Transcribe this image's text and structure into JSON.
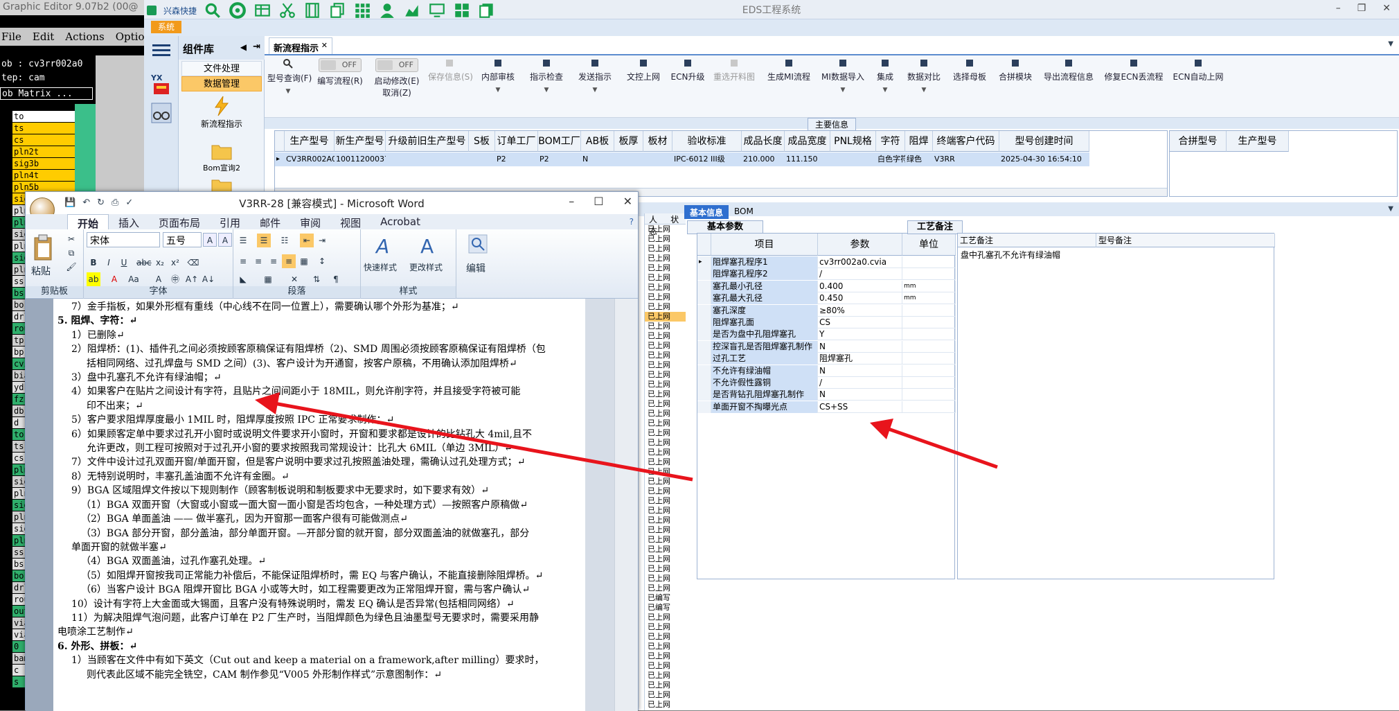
{
  "graphic_editor": {
    "title": "Graphic Editor 9.07b2 (00@",
    "menu": [
      "File",
      "Edit",
      "Actions",
      "Options"
    ],
    "job": "ob : cv3rr002a0",
    "step": "tep: cam",
    "matrix": "ob Matrix ...",
    "layers": [
      "to",
      "ts",
      "cs",
      "pln2t",
      "sig3b",
      "pln4t",
      "pln5b",
      "sig",
      "pln",
      "pln",
      "sig",
      "pln",
      "sig",
      "pln",
      "ss",
      "bs",
      "bo",
      "drl",
      "rou",
      "tp",
      "bp",
      "cvi",
      "bia",
      "ydk",
      "fzk",
      "db",
      "d",
      "to",
      "ts",
      "cs",
      "pln",
      "sig",
      "pln",
      "sig",
      "pln",
      "sig",
      "pln",
      "ss",
      "bs",
      "bo",
      "drl",
      "rou",
      "out",
      "via",
      "via",
      "0",
      "bam",
      "c",
      "s"
    ]
  },
  "eds": {
    "title": "EDS工程系统",
    "brand": "兴森快捷",
    "sys_tab": "系统",
    "library": {
      "title": "组件库",
      "items": [
        "文件处理",
        "数据管理"
      ],
      "icon_labels": [
        "新流程指示",
        "Bom宣询2"
      ]
    },
    "doc_tab": "新流程指示",
    "toolbar": {
      "model_query": "型号查询(F)",
      "edit_flow": "编写流程(R)",
      "start_modify": "启动修改(E)",
      "cancel": "取消(Z)",
      "toggle_off": "OFF",
      "items": [
        "保存信息(S)",
        "内部审核",
        "指示检查",
        "发送指示",
        "文控上网",
        "ECN升级",
        "重选开料图",
        "生成MI流程",
        "MI数据导入",
        "集成",
        "数据对比",
        "选择母板",
        "合拼模块",
        "导出流程信息",
        "修复ECN丢流程",
        "ECN自动上网"
      ]
    },
    "main_info": "主要信息",
    "grid": {
      "headers": [
        "生产型号",
        "新生产型号",
        "升级前旧生产型号",
        "S板",
        "订单工厂",
        "BOM工厂",
        "AB板",
        "板厚",
        "板材",
        "验收标准",
        "成品长度",
        "成品宽度",
        "PNL规格",
        "字符",
        "阻焊",
        "终端客户代码",
        "型号创建时间"
      ],
      "row": [
        "CV3RR002A0",
        "10011200037240",
        "",
        "",
        "P2",
        "P2",
        "N",
        "",
        "",
        "IPC-6012 III级",
        "210.000",
        "111.150",
        "",
        "白色字符",
        "绿色",
        "V3RR",
        "2025-04-30 16:54:10"
      ]
    },
    "grid2_headers": [
      "合拼型号",
      "生产型号"
    ],
    "lower_tabs": [
      "基本信息",
      "BOM"
    ],
    "basic_params": "基本参数",
    "process_tab": "工艺备注",
    "params": {
      "headers": [
        "项目",
        "参数",
        "单位"
      ],
      "rows": [
        [
          "阻焊塞孔程序1",
          "cv3rr002a0.cvia",
          ""
        ],
        [
          "阻焊塞孔程序2",
          "/",
          ""
        ],
        [
          "塞孔最小孔径",
          "0.400",
          "mm"
        ],
        [
          "塞孔最大孔径",
          "0.450",
          "mm"
        ],
        [
          "塞孔深度",
          "≥80%",
          ""
        ],
        [
          "阻焊塞孔面",
          "CS",
          ""
        ],
        [
          "是否为盘中孔阻焊塞孔",
          "Y",
          ""
        ],
        [
          "控深盲孔是否阻焊塞孔制作",
          "N",
          ""
        ],
        [
          "过孔工艺",
          "阻焊塞孔",
          ""
        ],
        [
          "不允许有绿油帽",
          "N",
          ""
        ],
        [
          "不允许假性露铜",
          "/",
          ""
        ],
        [
          "是否背钻孔阻焊塞孔制作",
          "N",
          ""
        ],
        [
          "单面开窗不掏曝光点",
          "CS+SS",
          ""
        ]
      ]
    },
    "process": {
      "headers": [
        "工艺备注",
        "型号备注"
      ],
      "note": "盘中孔塞孔不允许有绿油帽"
    },
    "status_header": "状态",
    "status_col_left": "人",
    "status_rows": [
      "已上网",
      "已上网",
      "已上网",
      "已上网",
      "已上网",
      "已上网",
      "已上网",
      "已上网",
      "已上网",
      "已上网",
      "已上网",
      "已上网",
      "已上网",
      "已上网",
      "已上网",
      "已上网",
      "已上网",
      "已上网",
      "已上网",
      "已上网",
      "已上网",
      "已上网",
      "已上网",
      "已上网",
      "已上网",
      "已上网",
      "已上网",
      "已上网",
      "已上网",
      "已上网",
      "已上网",
      "已上网",
      "已上网",
      "已上网",
      "已上网",
      "已上网",
      "已上网",
      "已上网",
      "已编写",
      "已编写",
      "已上网",
      "已上网",
      "已上网",
      "已上网",
      "已上网",
      "已上网",
      "已上网",
      "已上网",
      "已上网",
      "已上网"
    ]
  },
  "word": {
    "title": "V3RR-28 [兼容模式] - Microsoft Word",
    "tabs": [
      "开始",
      "插入",
      "页面布局",
      "引用",
      "邮件",
      "审阅",
      "视图",
      "Acrobat"
    ],
    "font_name": "宋体",
    "font_size": "五号",
    "groups": [
      "剪贴板",
      "字体",
      "段落",
      "样式"
    ],
    "paste": "粘贴",
    "quick_styles": "快速样式",
    "change_styles": "更改样式",
    "edit": "编辑",
    "lines": [
      {
        "t": "7）金手指板，如果外形框有重线（中心线不在同一位置上），需要确认哪个外形为基准；↵",
        "i": 60,
        "b": false
      },
      {
        "t": "5.   阻焊、字符：↵",
        "i": 38,
        "b": true
      },
      {
        "t": "1）已删除↵",
        "i": 60,
        "b": false
      },
      {
        "t": "2）阻焊桥：(1)、插件孔之间必须按顾客原稿保证有阻焊桥（2)、SMD 周围必须按顾客原稿保证有阻焊桥（包",
        "i": 60,
        "b": false
      },
      {
        "t": "括相同网络、过孔焊盘与 SMD 之间）(3)、客户设计为开通窗，按客户原稿，不用确认添加阻焊桥↵",
        "i": 82,
        "b": false
      },
      {
        "t": "3）盘中孔塞孔不允许有绿油帽；↵",
        "i": 60,
        "b": false
      },
      {
        "t": "4）如果客户在贴片之间设计有字符，且贴片之间间距小于 18MIL，则允许削字符，并且接受字符被可能",
        "i": 60,
        "b": false
      },
      {
        "t": "印不出来；↵",
        "i": 82,
        "b": false
      },
      {
        "t": "5）客户要求阻焊厚度最小 1MIL 时，阻焊厚度按照 IPC 正常要求制作；↵",
        "i": 60,
        "b": false
      },
      {
        "t": "6）如果顾客定单中要求过孔开小窗时或说明文件要求开小窗时，开窗和要求都是设计的比钻孔大 4mil,且不",
        "i": 60,
        "b": false
      },
      {
        "t": "允许更改，则工程可按照对于过孔开小窗的要求按照我司常规设计：比孔大 6MIL（单边 3MIL）↵",
        "i": 82,
        "b": false
      },
      {
        "t": "7）文件中设计过孔双面开窗/单面开窗，但是客户说明中要求过孔按照盖油处理，需确认过孔处理方式；↵",
        "i": 60,
        "b": false
      },
      {
        "t": "8）无特别说明时，丰塞孔盖油面不允许有金圈。↵",
        "i": 60,
        "b": false
      },
      {
        "t": "9）BGA 区域阻焊文件按以下规则制作（顾客制板说明和制板要求中无要求时，如下要求有效）↵",
        "i": 60,
        "b": false
      },
      {
        "t": "（1）BGA 双面开窗（大窗或小窗或一面大窗一面小窗是否均包含，一种处理方式）—按照客户原稿做↵",
        "i": 74,
        "b": false
      },
      {
        "t": "（2）BGA 单面盖油 —— 做半塞孔，因为开窗那一面客户很有可能做测点↵",
        "i": 74,
        "b": false
      },
      {
        "t": "（3）BGA 部分开窗，部分盖油，部分单面开窗。—开部分窗的就开窗，部分双面盖油的就做塞孔，部分",
        "i": 74,
        "b": false
      },
      {
        "t": "单面开窗的就做半塞↵",
        "i": 60,
        "b": false
      },
      {
        "t": "（4）BGA 双面盖油，过孔作塞孔处理。↵",
        "i": 74,
        "b": false
      },
      {
        "t": "（5）如阻焊开窗按我司正常能力补偿后，不能保证阻焊桥时，需 EQ 与客户确认，不能直接删除阻焊桥。↵",
        "i": 74,
        "b": false
      },
      {
        "t": "（6）当客户设计 BGA 阻焊开窗比 BGA 小或等大时，如工程需要更改为正常阻焊开窗，需与客户确认↵",
        "i": 74,
        "b": false
      },
      {
        "t": "10）设计有字符上大金面或大锡面，且客户没有特殊说明时，需发 EQ 确认是否异常(包括相同网络）↵",
        "i": 60,
        "b": false
      },
      {
        "t": "11）为解决阻焊气泡问题，此客户订单在 P2 厂生产时，当阻焊颜色为绿色且油墨型号无要求时，需要采用静",
        "i": 60,
        "b": false
      },
      {
        "t": "电喷涂工艺制作↵",
        "i": 38,
        "b": false
      },
      {
        "t": "6.   外形、拼板：↵",
        "i": 38,
        "b": true
      },
      {
        "t": "1）当顾客在文件中有如下英文（Cut out and keep a material on a framework,after milling）要求时，",
        "i": 60,
        "b": false
      },
      {
        "t": "则代表此区域不能完全铣空，CAM 制作参见“V005 外形制作样式”示意图制作：↵",
        "i": 82,
        "b": false
      }
    ]
  },
  "colors": {
    "arrow": "#e8141c",
    "accent": "#2f6fcf",
    "sys_tab": "#f29a1b",
    "selected_row": "#cfe0f6"
  }
}
